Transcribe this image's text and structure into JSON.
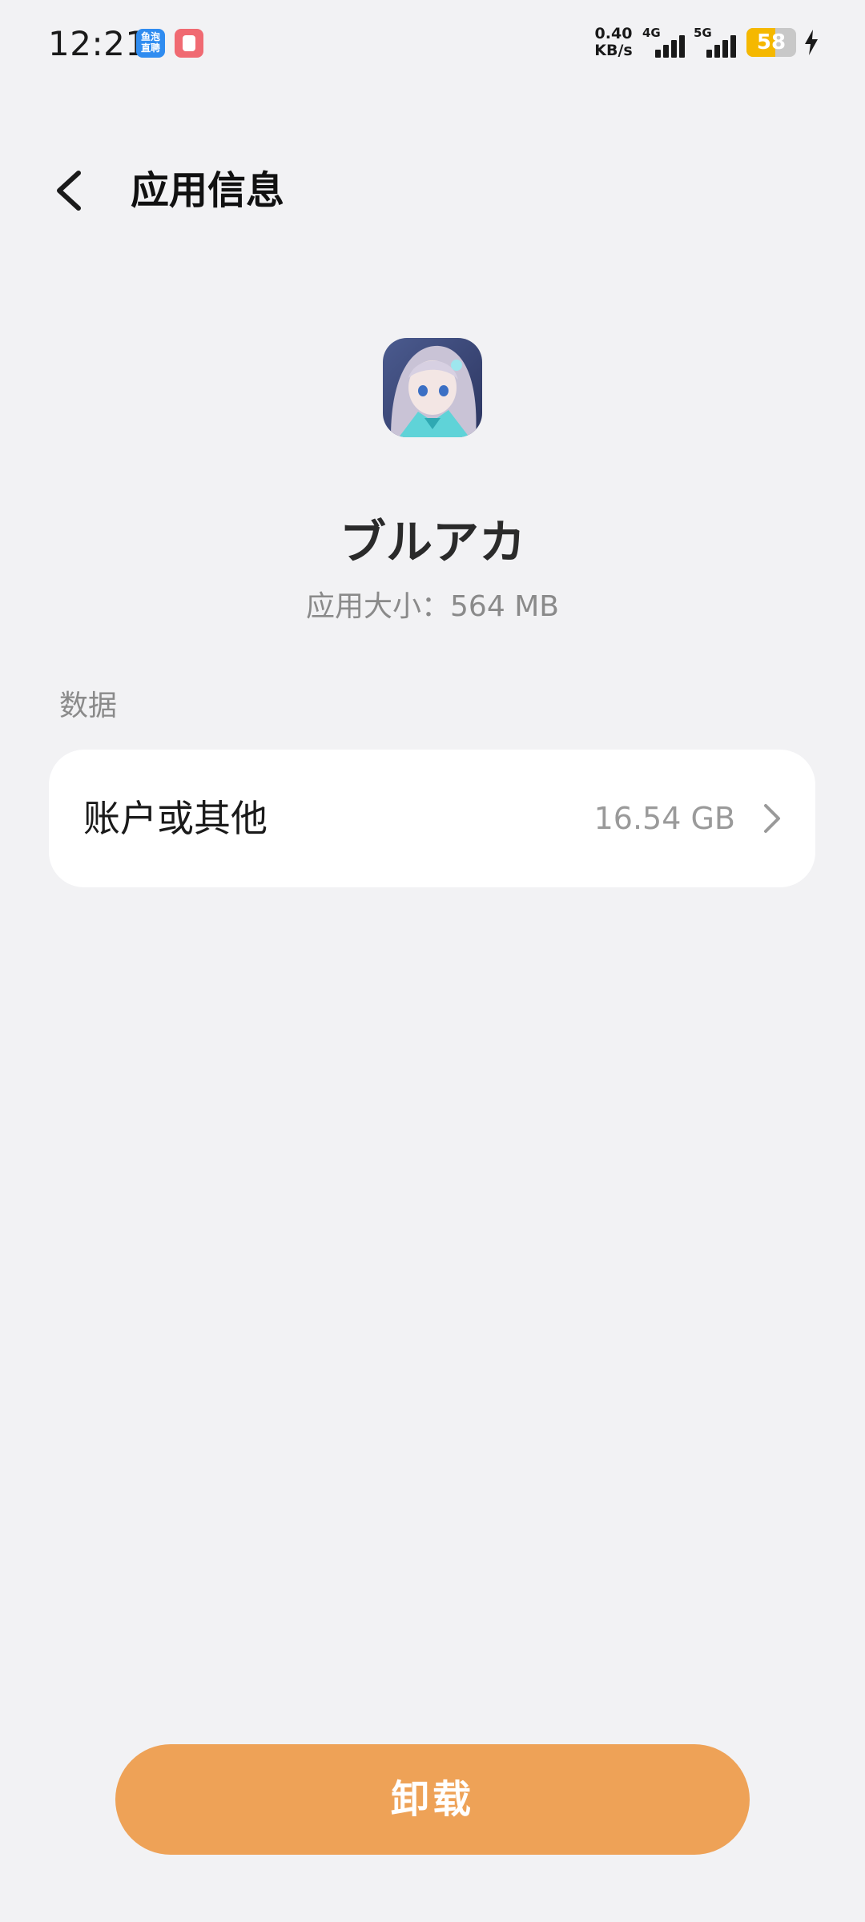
{
  "status_bar": {
    "time": "12:21",
    "notif_icon_blue_line1": "鱼泡",
    "notif_icon_blue_line2": "直聘",
    "net_speed_value": "0.40",
    "net_speed_unit": "KB/s",
    "signal_1_label": "4G",
    "signal_2_label": "5G",
    "battery_level": "58",
    "battery_color": "#f5b800",
    "charging_icon": "lightning-icon"
  },
  "header": {
    "title": "应用信息",
    "back_icon": "chevron-left-icon"
  },
  "app": {
    "name": "ブルアカ",
    "size_text": "应用大小：564 MB"
  },
  "data_section": {
    "label": "数据",
    "rows": [
      {
        "label": "账户或其他",
        "value": "16.54 GB",
        "icon": "chevron-right-icon"
      }
    ]
  },
  "actions": {
    "uninstall_label": "卸载",
    "uninstall_color": "#eea257"
  }
}
